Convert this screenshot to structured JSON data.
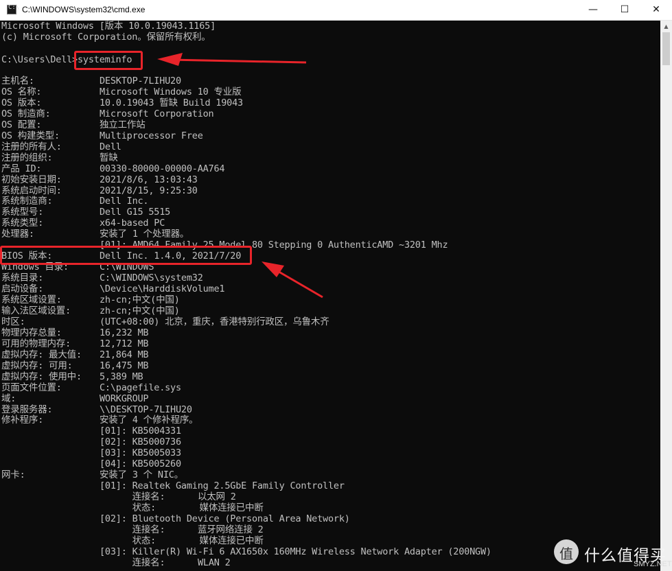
{
  "window": {
    "title": "C:\\WINDOWS\\system32\\cmd.exe",
    "icon": "cmd-icon",
    "controls": {
      "minimize": "—",
      "maximize": "☐",
      "close": "✕"
    }
  },
  "console": {
    "header_lines": [
      "Microsoft Windows [版本 10.0.19043.1165]",
      "(c) Microsoft Corporation。保留所有权利。"
    ],
    "prompt": "C:\\Users\\Dell>",
    "command": "systeminfo",
    "rows": [
      {
        "label": "主机名:",
        "value": "DESKTOP-7LIHU20"
      },
      {
        "label": "OS 名称:",
        "value": "Microsoft Windows 10 专业版"
      },
      {
        "label": "OS 版本:",
        "value": "10.0.19043 暂缺 Build 19043"
      },
      {
        "label": "OS 制造商:",
        "value": "Microsoft Corporation"
      },
      {
        "label": "OS 配置:",
        "value": "独立工作站"
      },
      {
        "label": "OS 构建类型:",
        "value": "Multiprocessor Free"
      },
      {
        "label": "注册的所有人:",
        "value": "Dell"
      },
      {
        "label": "注册的组织:",
        "value": "暂缺"
      },
      {
        "label": "产品 ID:",
        "value": "00330-80000-00000-AA764"
      },
      {
        "label": "初始安装日期:",
        "value": "2021/8/6, 13:03:43"
      },
      {
        "label": "系统启动时间:",
        "value": "2021/8/15, 9:25:30"
      },
      {
        "label": "系统制造商:",
        "value": "Dell Inc."
      },
      {
        "label": "系统型号:",
        "value": "Dell G15 5515"
      },
      {
        "label": "系统类型:",
        "value": "x64-based PC"
      },
      {
        "label": "处理器:",
        "value": "安装了 1 个处理器。"
      },
      {
        "label": "",
        "value": "[01]: AMD64 Family 25 Model 80 Stepping 0 AuthenticAMD ~3201 Mhz"
      },
      {
        "label": "BIOS 版本:",
        "value": "Dell Inc. 1.4.0, 2021/7/20"
      },
      {
        "label": "Windows 目录:",
        "value": "C:\\WINDOWS"
      },
      {
        "label": "系统目录:",
        "value": "C:\\WINDOWS\\system32"
      },
      {
        "label": "启动设备:",
        "value": "\\Device\\HarddiskVolume1"
      },
      {
        "label": "系统区域设置:",
        "value": "zh-cn;中文(中国)"
      },
      {
        "label": "输入法区域设置:",
        "value": "zh-cn;中文(中国)"
      },
      {
        "label": "时区:",
        "value": "(UTC+08:00) 北京，重庆，香港特别行政区，乌鲁木齐"
      },
      {
        "label": "物理内存总量:",
        "value": "16,232 MB"
      },
      {
        "label": "可用的物理内存:",
        "value": "12,712 MB"
      },
      {
        "label": "虚拟内存: 最大值:",
        "value": "21,864 MB"
      },
      {
        "label": "虚拟内存: 可用:",
        "value": "16,475 MB"
      },
      {
        "label": "虚拟内存: 使用中:",
        "value": "5,389 MB"
      },
      {
        "label": "页面文件位置:",
        "value": "C:\\pagefile.sys"
      },
      {
        "label": "域:",
        "value": "WORKGROUP"
      },
      {
        "label": "登录服务器:",
        "value": "\\\\DESKTOP-7LIHU20"
      },
      {
        "label": "修补程序:",
        "value": "安装了 4 个修补程序。"
      },
      {
        "label": "",
        "value": "[01]: KB5004331"
      },
      {
        "label": "",
        "value": "[02]: KB5000736"
      },
      {
        "label": "",
        "value": "[03]: KB5005033"
      },
      {
        "label": "",
        "value": "[04]: KB5005260"
      },
      {
        "label": "网卡:",
        "value": "安装了 3 个 NIC。"
      },
      {
        "label": "",
        "value": "[01]: Realtek Gaming 2.5GbE Family Controller"
      },
      {
        "label": "",
        "value": "      连接名:      以太网 2"
      },
      {
        "label": "",
        "value": "      状态:        媒体连接已中断"
      },
      {
        "label": "",
        "value": "[02]: Bluetooth Device (Personal Area Network)"
      },
      {
        "label": "",
        "value": "      连接名:      蓝牙网络连接 2"
      },
      {
        "label": "",
        "value": "      状态:        媒体连接已中断"
      },
      {
        "label": "",
        "value": "[03]: Killer(R) Wi-Fi 6 AX1650x 160MHz Wireless Network Adapter (200NGW)"
      },
      {
        "label": "",
        "value": "      连接名:      WLAN 2"
      }
    ]
  },
  "watermark": {
    "glyph": "值",
    "text": "什么值得买",
    "sub": "SMYZ.NET"
  },
  "colors": {
    "console_bg": "#0c0c0c",
    "console_text": "#c0c0c0",
    "annotation_red": "#e8242a"
  }
}
